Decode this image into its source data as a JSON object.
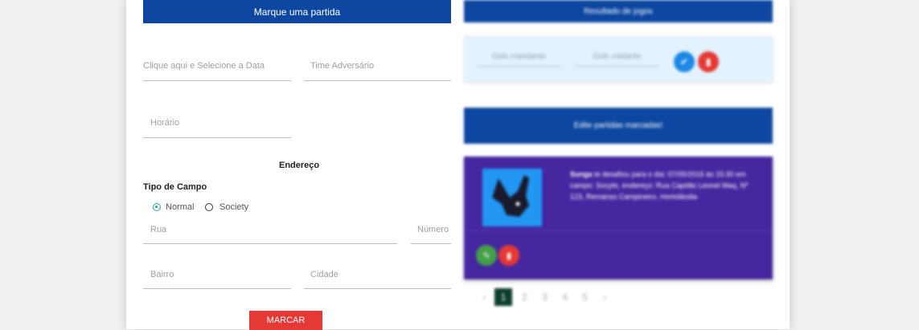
{
  "form": {
    "header_button": "Marque uma partida",
    "date_placeholder": "Clique aqui e Selecione a Data",
    "opponent_placeholder": "Time Adversário",
    "time_placeholder": "Horário",
    "address_title": "Endereço",
    "field_type_title": "Tipo de Campo",
    "field_types": [
      {
        "label": "Normal",
        "checked": true
      },
      {
        "label": "Society",
        "checked": false
      }
    ],
    "street_placeholder": "Rua",
    "number_placeholder": "Número",
    "district_placeholder": "Bairro",
    "city_placeholder": "Cidade",
    "submit_label": "MARCAR"
  },
  "results": {
    "header_button": "Resultado de jogos",
    "score_home_placeholder": "Gols mandante",
    "score_away_placeholder": "Gols visitante",
    "confirm_icon": "check-icon",
    "message_icon": "message-icon"
  },
  "scheduled": {
    "header_button": "Edite partidas marcadas!",
    "match_card": {
      "team": "Sunga",
      "text": "te desafiou para o dia: 07/05/2016 às 15:30 em campo: Socyte, endereço: Rua Capitão Leonel Maq, Nº 123, Remanso Campineiro, Hortolândia",
      "edit_icon": "pencil-icon",
      "delete_icon": "trash-icon"
    },
    "pagination": {
      "prev": "‹",
      "pages": [
        "1",
        "2",
        "3",
        "4",
        "5"
      ],
      "active": "1",
      "next": "›"
    }
  },
  "colors": {
    "primary": "#0d47a1",
    "danger": "#e53935",
    "card_purple": "#4527a0",
    "radio_teal": "#26a69a",
    "result_box_bg": "#e3f2fd"
  }
}
